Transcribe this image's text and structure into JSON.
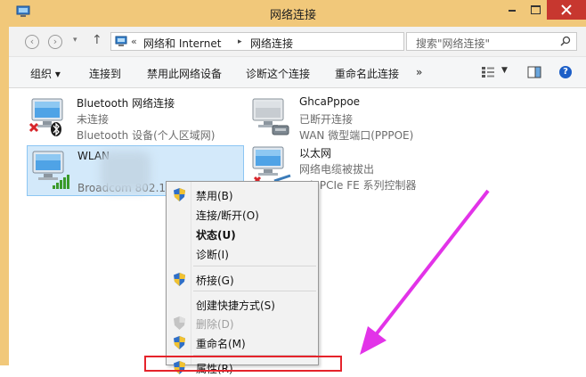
{
  "window": {
    "title": "网络连接",
    "accent": "#f1c87a",
    "close_color": "#c7372f"
  },
  "address_bar": {
    "overflow": "«",
    "crumb_1": "网络和 Internet",
    "separator": "▸",
    "crumb_2": "网络连接",
    "dropdown_glyph": "v",
    "refresh_glyph": "↻"
  },
  "search": {
    "placeholder": "搜索\"网络连接\""
  },
  "toolbar": {
    "organize": "组织 ▾",
    "connect": "连接到",
    "disable": "禁用此网络设备",
    "diagnose": "诊断这个连接",
    "rename": "重命名此连接",
    "more": "»",
    "help": "?"
  },
  "connections": [
    {
      "name": "Bluetooth 网络连接",
      "status": "未连接",
      "device": "Bluetooth 设备(个人区域网)",
      "icon": "bluetooth-adapter-icon"
    },
    {
      "name": "GhcaPppoe",
      "status": "已断开连接",
      "device": "WAN 微型端口(PPPOE)",
      "icon": "dialup-adapter-icon"
    },
    {
      "name": "WLAN",
      "status": "",
      "device": "Broadcom 802.11",
      "icon": "wifi-adapter-icon",
      "selected": true
    },
    {
      "name": "以太网",
      "status": "网络电缆被拔出",
      "device": "tek PCIe FE 系列控制器",
      "icon": "ethernet-adapter-icon"
    }
  ],
  "context_menu": {
    "items": [
      {
        "label": "禁用(B)",
        "shield": true
      },
      {
        "label": "连接/断开(O)"
      },
      {
        "label": "状态(U)",
        "bold": true
      },
      {
        "label": "诊断(I)"
      },
      {
        "label": "桥接(G)",
        "shield": true
      },
      {
        "label": "创建快捷方式(S)"
      },
      {
        "label": "删除(D)",
        "shield": true,
        "disabled": true
      },
      {
        "label": "重命名(M)",
        "shield": true
      },
      {
        "label": "属性(R)",
        "shield": true
      }
    ]
  },
  "annotations": {
    "arrow_color": "#e233e8",
    "highlight_color": "#e5232b"
  }
}
